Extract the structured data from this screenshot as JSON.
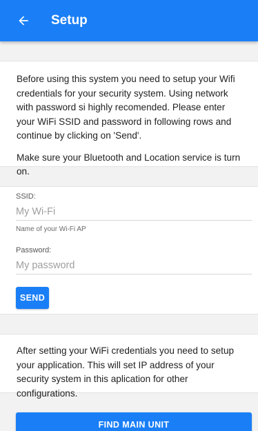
{
  "app_bar": {
    "title": "Setup",
    "back_icon": "arrow-left-icon",
    "color": "#1a7ff7"
  },
  "intro": {
    "paragraph_1": "Before using this system you need to setup your Wifi credentials for your security system. Using network with password si highly recomended. Please enter your WiFi SSID and password in following rows and continue by clicking on 'Send'.",
    "paragraph_2": "Make sure your Bluetooth and Location service is turn on."
  },
  "form": {
    "ssid": {
      "label": "SSID:",
      "value": "",
      "placeholder": "My Wi-Fi",
      "helper": "Name of your Wi-Fi AP"
    },
    "password": {
      "label": "Password:",
      "value": "",
      "placeholder": "My password"
    },
    "send_label": "SEND"
  },
  "app_setup": {
    "paragraph": "After setting your WiFi credentials you need to setup your application. This will set IP address of your security system in this aplication for other configurations."
  },
  "find_button_label": "FIND MAIN UNIT"
}
